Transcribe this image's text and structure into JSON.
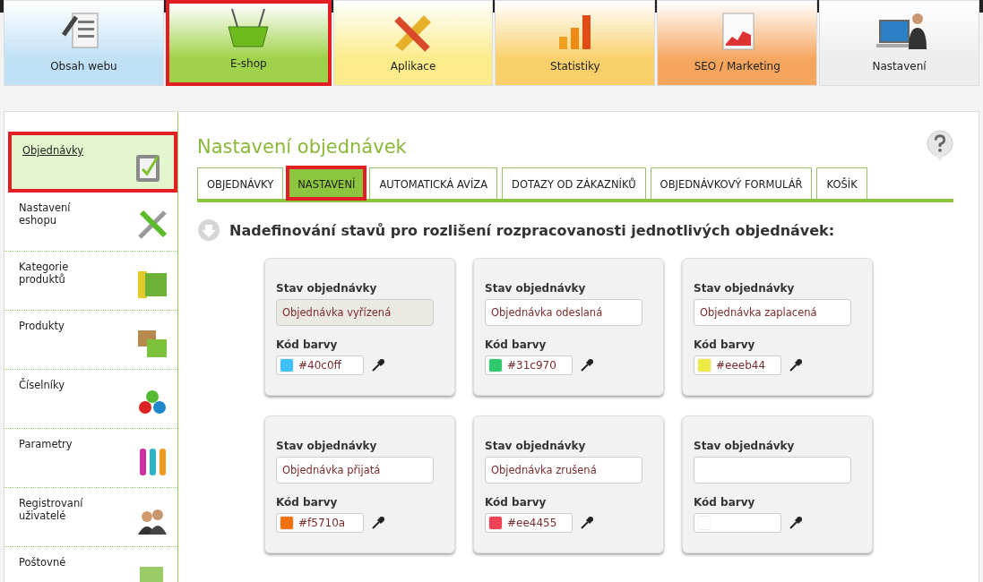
{
  "top_nav": [
    {
      "label": "Obsah webu",
      "selected": false,
      "color": "#bfe0f5"
    },
    {
      "label": "E-shop",
      "selected": true,
      "color": "#9fd24a"
    },
    {
      "label": "Aplikace",
      "selected": false,
      "color": "#fbeb8a"
    },
    {
      "label": "Statistiky",
      "selected": false,
      "color": "#f9cf6a"
    },
    {
      "label": "SEO / Marketing",
      "selected": false,
      "color": "#f6a55e"
    },
    {
      "label": "Nastavení",
      "selected": false,
      "color": "#ededed"
    }
  ],
  "sidebar": {
    "items": [
      {
        "label": "Objednávky",
        "selected": true
      },
      {
        "label": "Nastavení eshopu",
        "selected": false
      },
      {
        "label": "Kategorie produktů",
        "selected": false
      },
      {
        "label": "Produkty",
        "selected": false
      },
      {
        "label": "Číselníky",
        "selected": false
      },
      {
        "label": "Parametry",
        "selected": false
      },
      {
        "label": "Registrovaní uživatelé",
        "selected": false
      },
      {
        "label": "Poštovné",
        "selected": false
      }
    ]
  },
  "page_title": "Nastavení objednávek",
  "tabs": [
    {
      "label": "OBJEDNÁVKY",
      "selected": false
    },
    {
      "label": "NASTAVENÍ",
      "selected": true
    },
    {
      "label": "AUTOMATICKÁ AVÍZA",
      "selected": false
    },
    {
      "label": "DOTAZY OD ZÁKAZNÍKŮ",
      "selected": false
    },
    {
      "label": "OBJEDNÁVKOVÝ FORMULÁŘ",
      "selected": false
    },
    {
      "label": "KOŠÍK",
      "selected": false
    }
  ],
  "section_heading": "Nadefinování stavů pro rozlišení rozpracovanosti jednotlivých objednávek:",
  "status_cards": [
    {
      "status_label": "Stav objednávky",
      "status_value": "Objednávka vyřízená",
      "disabled": true,
      "color_label": "Kód barvy",
      "color_code": "#40c0ff",
      "color": "#40c0ff"
    },
    {
      "status_label": "Stav objednávky",
      "status_value": "Objednávka odeslaná",
      "disabled": false,
      "color_label": "Kód barvy",
      "color_code": "#31c970",
      "color": "#31c970"
    },
    {
      "status_label": "Stav objednávky",
      "status_value": "Objednávka zaplacená",
      "disabled": false,
      "color_label": "Kód barvy",
      "color_code": "#eeeb44",
      "color": "#eeeb44"
    },
    {
      "status_label": "Stav objednávky",
      "status_value": "Objednávka přijatá",
      "disabled": false,
      "color_label": "Kód barvy",
      "color_code": "#f5710a",
      "color": "#f5710a"
    },
    {
      "status_label": "Stav objednávky",
      "status_value": "Objednávka zrušená",
      "disabled": false,
      "color_label": "Kód barvy",
      "color_code": "#ee4455",
      "color": "#ee4455"
    },
    {
      "status_label": "Stav objednávky",
      "disabled": false,
      "color_label": "Kód barvy"
    }
  ]
}
